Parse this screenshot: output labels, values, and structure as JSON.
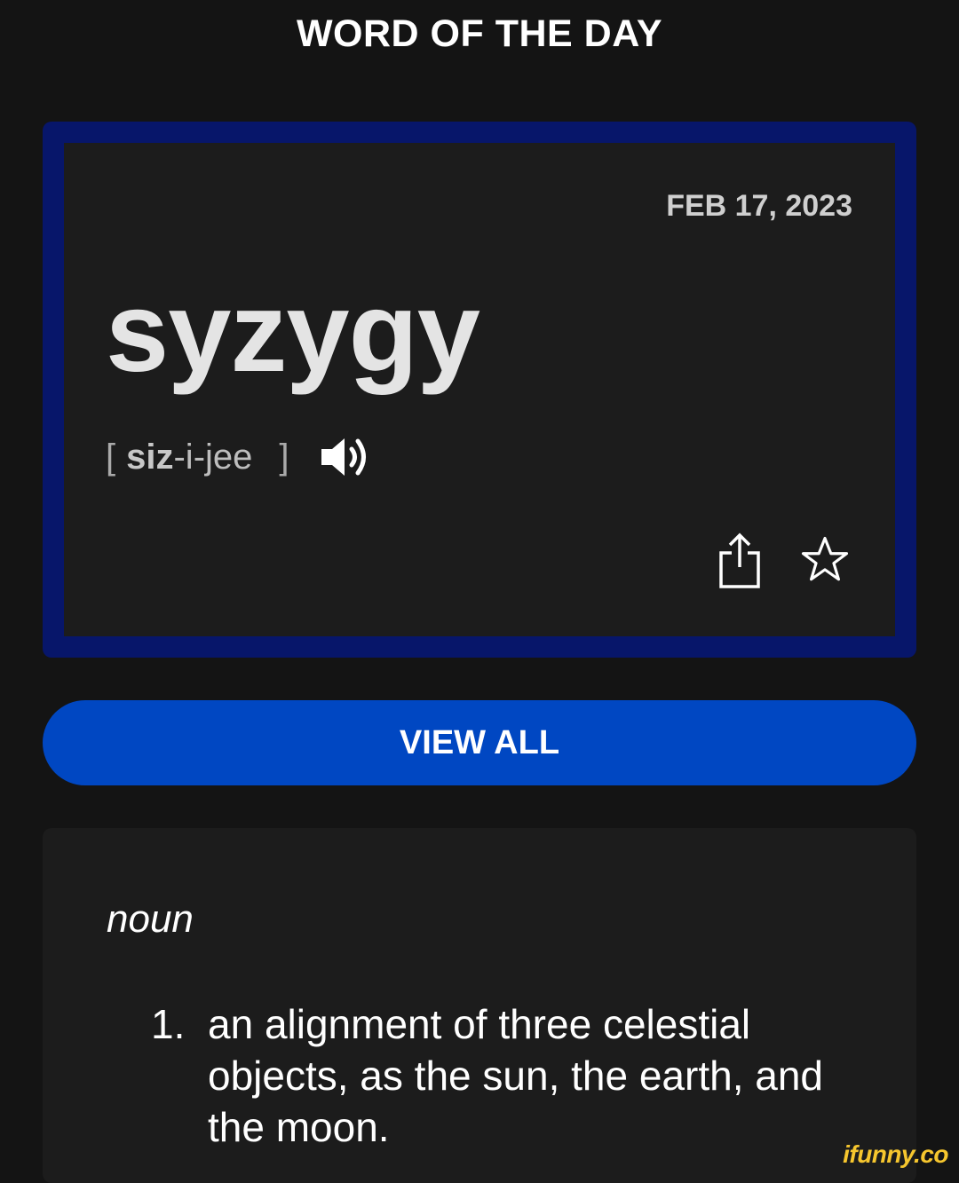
{
  "header": {
    "title": "WORD OF THE DAY"
  },
  "word_card": {
    "date": "FEB 17, 2023",
    "word": "syzygy",
    "pronunciation": {
      "open_bracket": "[",
      "stressed": "siz",
      "rest": "-i-jee",
      "close_bracket": "]"
    },
    "icons": {
      "audio": "speaker-icon",
      "share": "share-icon",
      "favorite": "star-icon"
    },
    "border_color": "#07166a"
  },
  "view_all": {
    "label": "VIEW ALL",
    "color": "#0047c2"
  },
  "definition": {
    "part_of_speech": "noun",
    "entries": [
      {
        "number": "1.",
        "text": "an alignment of three celestial objects, as the sun, the earth, and the moon."
      }
    ]
  },
  "watermark": {
    "text": "ifunny.co",
    "color": "#f6c62e"
  }
}
